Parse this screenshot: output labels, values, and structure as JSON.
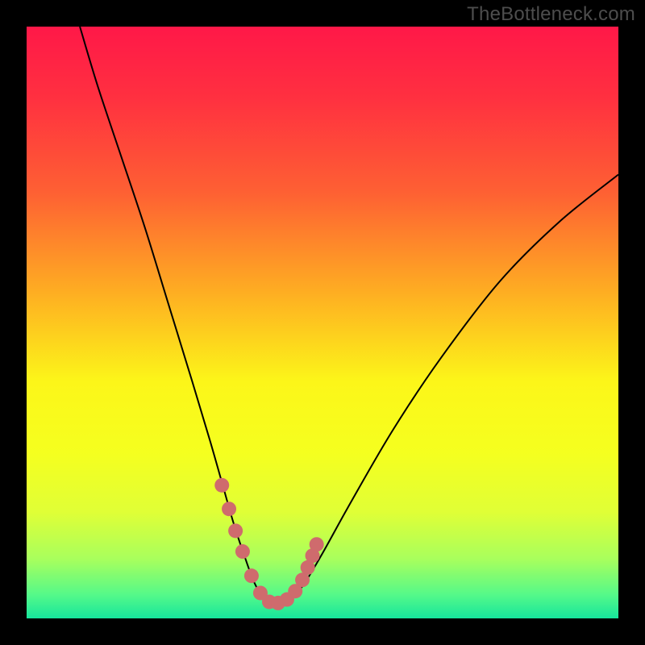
{
  "watermark": "TheBottleneck.com",
  "colors": {
    "frame": "#000000",
    "curve_stroke": "#000000",
    "marker_fill": "#cf6b6d",
    "gradient_stops": [
      {
        "offset": 0.0,
        "color": "#ff1848"
      },
      {
        "offset": 0.12,
        "color": "#ff3040"
      },
      {
        "offset": 0.28,
        "color": "#fe6033"
      },
      {
        "offset": 0.45,
        "color": "#feae22"
      },
      {
        "offset": 0.6,
        "color": "#fcf619"
      },
      {
        "offset": 0.72,
        "color": "#f5ff1f"
      },
      {
        "offset": 0.82,
        "color": "#e0ff36"
      },
      {
        "offset": 0.9,
        "color": "#a8ff5d"
      },
      {
        "offset": 0.96,
        "color": "#55f989"
      },
      {
        "offset": 1.0,
        "color": "#16e59c"
      }
    ]
  },
  "chart_data": {
    "type": "line",
    "title": "",
    "xlabel": "",
    "ylabel": "",
    "xlim": [
      0,
      100
    ],
    "ylim": [
      0,
      100
    ],
    "series": [
      {
        "name": "bottleneck-curve",
        "x": [
          9,
          12,
          16,
          20,
          24,
          28,
          31,
          33,
          35,
          37,
          38.5,
          40,
          41.5,
          43,
          45,
          47,
          50,
          55,
          62,
          70,
          80,
          90,
          100
        ],
        "y": [
          100,
          90,
          78,
          66,
          53,
          40,
          30,
          23,
          16,
          10,
          6,
          3.5,
          2.5,
          2.5,
          3.5,
          6,
          11,
          20,
          32,
          44,
          57,
          67,
          75
        ]
      }
    ],
    "markers": {
      "name": "highlight-dots",
      "x": [
        33.0,
        34.2,
        35.3,
        36.5,
        38.0,
        39.5,
        41.0,
        42.5,
        44.0,
        45.4,
        46.6,
        47.5,
        48.3,
        49.0
      ],
      "y": [
        22.5,
        18.5,
        14.8,
        11.3,
        7.2,
        4.3,
        2.8,
        2.6,
        3.2,
        4.6,
        6.5,
        8.6,
        10.6,
        12.5
      ]
    }
  }
}
